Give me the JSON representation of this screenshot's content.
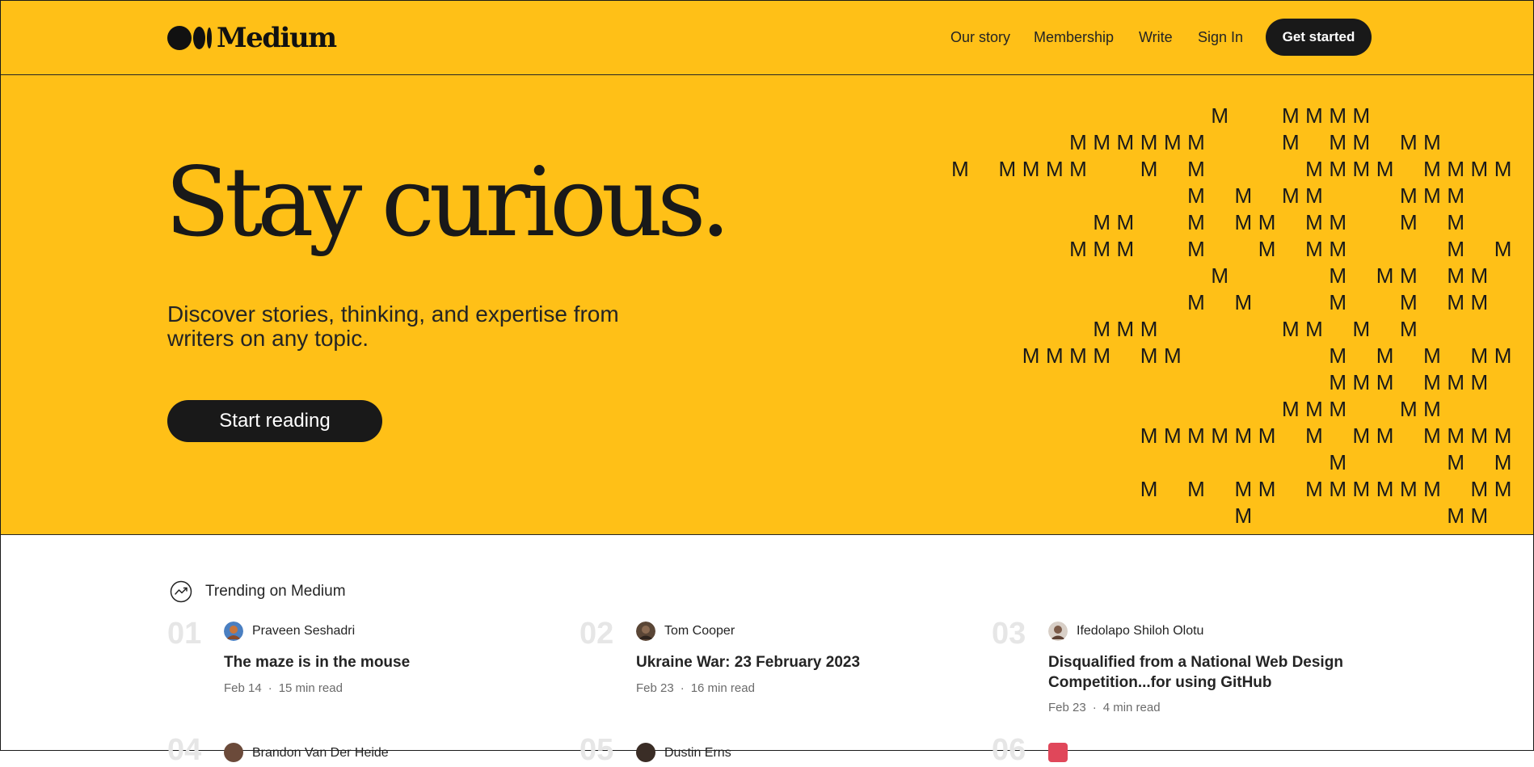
{
  "nav": {
    "logo_text": "Medium",
    "links": [
      "Our story",
      "Membership",
      "Write",
      "Sign In"
    ],
    "cta": "Get started"
  },
  "hero": {
    "title": "Stay curious.",
    "subtitle": "Discover stories, thinking, and expertise from writers on any topic.",
    "cta": "Start reading",
    "pattern_glyph": "M"
  },
  "trending": {
    "heading": "Trending on Medium",
    "items": [
      {
        "num": "01",
        "author": "Praveen Seshadri",
        "title": "The maze is in the mouse",
        "date": "Feb 14",
        "read_time": "15 min read"
      },
      {
        "num": "02",
        "author": "Tom Cooper",
        "title": "Ukraine War: 23 February 2023",
        "date": "Feb 23",
        "read_time": "16 min read"
      },
      {
        "num": "03",
        "author": "Ifedolapo Shiloh Olotu",
        "title": "Disqualified from a National Web Design Competition...for using GitHub",
        "date": "Feb 23",
        "read_time": "4 min read"
      }
    ],
    "peek": [
      {
        "num": "04",
        "author": "Brandon Van Der Heide"
      },
      {
        "num": "05",
        "author": "Dustin Erns"
      },
      {
        "num": "06",
        "author": ""
      }
    ]
  },
  "colors": {
    "brand_yellow": "#ffc017",
    "ink": "#191919",
    "muted": "#6b6b6b",
    "num_gray": "#e6e6e6"
  }
}
